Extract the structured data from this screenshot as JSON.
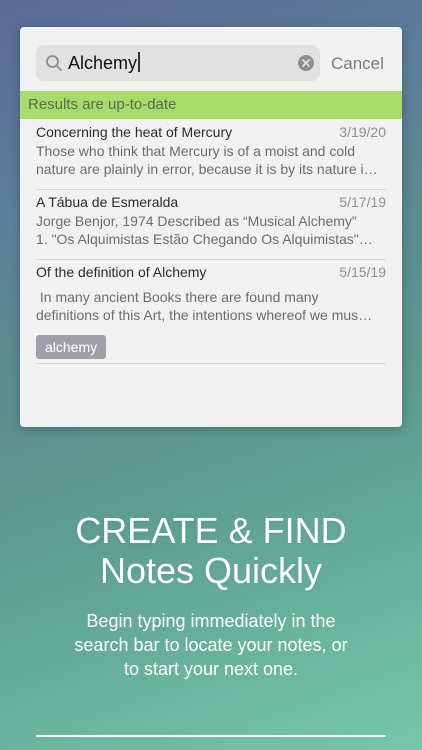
{
  "search": {
    "query": "Alchemy",
    "cancel_label": "Cancel"
  },
  "status": {
    "text": "Results are up-to-date",
    "color": "#a8dc6a"
  },
  "notes": [
    {
      "title": "Concerning the heat of Mercury",
      "date": "3/19/20",
      "lines": [
        "Those who think that Mercury is of a moist and cold",
        "nature are plainly in error, because it is by its nature i…"
      ]
    },
    {
      "title": "A Tábua de Esmeralda",
      "date": "5/17/19",
      "lines": [
        "Jorge Benjor, 1974 Described as “Musical Alchemy”",
        "1. \"Os Alquimistas Estão Chegando Os Alquimistas\"…"
      ]
    },
    {
      "title": "Of the definition of Alchemy",
      "date": "5/15/19",
      "lines": [
        " In many ancient Books there are found many",
        "definitions of this Art, the intentions whereof we mus…"
      ],
      "tag": "alchemy"
    }
  ],
  "promo": {
    "headline_line1": "CREATE & FIND",
    "headline_line2": "Notes Quickly",
    "sub_line1": "Begin typing immediately in the",
    "sub_line2": "search bar to locate your notes, or",
    "sub_line3": "to start your next one."
  },
  "icons": {
    "search": "search-icon",
    "clear": "clear-icon"
  }
}
